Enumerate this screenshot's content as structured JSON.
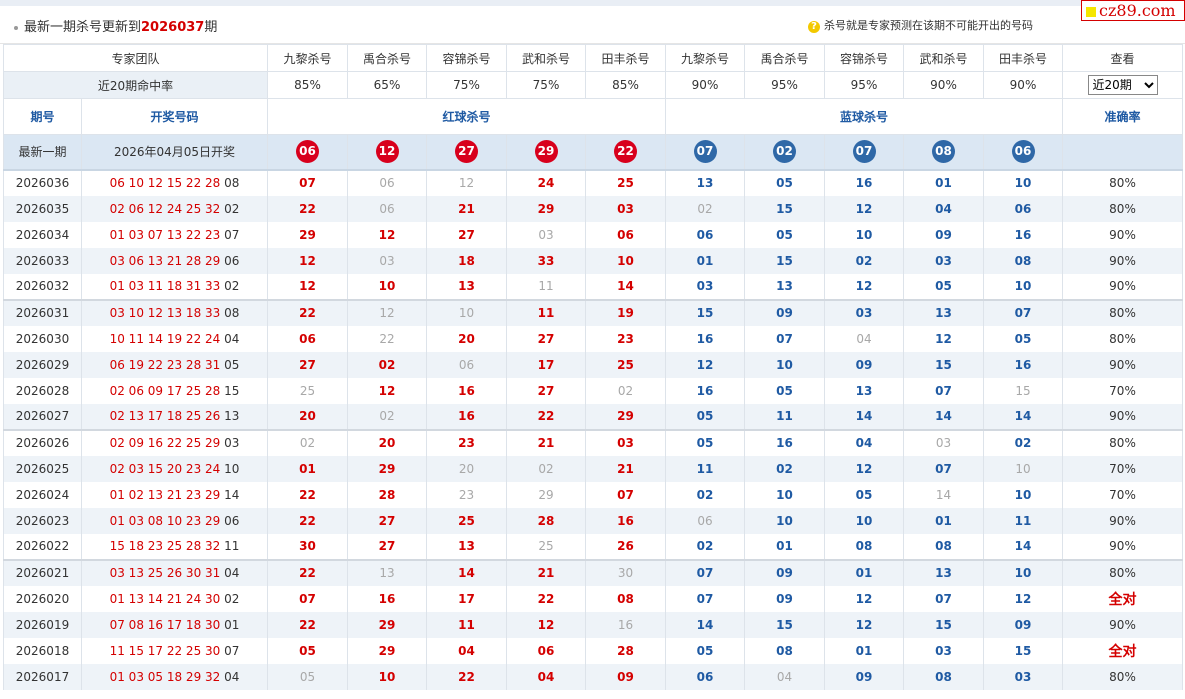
{
  "notice": {
    "prefix": "最新一期杀号更新到",
    "issue": "2026037",
    "suffix": "期"
  },
  "tip": {
    "icon": "question-icon",
    "text": "杀号就是专家预测在该期不可能开出的号码"
  },
  "logo": {
    "text": "cz89.com",
    "color": "#d40000"
  },
  "colors": {
    "red": "#d8001c",
    "blue": "#2f68a7",
    "header_bg": "#dbe7f3"
  },
  "experts": {
    "label": "专家团队",
    "names": [
      "九黎杀号",
      "禹合杀号",
      "容锦杀号",
      "武和杀号",
      "田丰杀号",
      "九黎杀号",
      "禹合杀号",
      "容锦杀号",
      "武和杀号",
      "田丰杀号"
    ],
    "view_label": "查看"
  },
  "hitrate": {
    "label": "近20期命中率",
    "values": [
      "85%",
      "65%",
      "75%",
      "75%",
      "85%",
      "90%",
      "95%",
      "95%",
      "90%",
      "90%"
    ],
    "select_value": "近20期"
  },
  "headers": {
    "issue": "期号",
    "draw": "开奖号码",
    "red": "红球杀号",
    "blue": "蓝球杀号",
    "accuracy": "准确率"
  },
  "latest": {
    "label": "最新一期",
    "date": "2026年04月05日开奖",
    "red": [
      "06",
      "12",
      "27",
      "29",
      "22"
    ],
    "blue": [
      "07",
      "02",
      "07",
      "08",
      "06"
    ]
  },
  "rows": [
    {
      "issue": "2026036",
      "draw": "06 10 12 15 22 28",
      "blue_ball": "08",
      "red": [
        "07",
        "06",
        "12",
        "24",
        "25"
      ],
      "blue": [
        "13",
        "05",
        "16",
        "01",
        "10"
      ],
      "acc": "80%"
    },
    {
      "issue": "2026035",
      "draw": "02 06 12 24 25 32",
      "blue_ball": "02",
      "red": [
        "22",
        "06",
        "21",
        "29",
        "03"
      ],
      "blue": [
        "02",
        "15",
        "12",
        "04",
        "06"
      ],
      "acc": "80%"
    },
    {
      "issue": "2026034",
      "draw": "01 03 07 13 22 23",
      "blue_ball": "07",
      "red": [
        "29",
        "12",
        "27",
        "03",
        "06"
      ],
      "blue": [
        "06",
        "05",
        "10",
        "09",
        "16"
      ],
      "acc": "90%"
    },
    {
      "issue": "2026033",
      "draw": "03 06 13 21 28 29",
      "blue_ball": "06",
      "red": [
        "12",
        "03",
        "18",
        "33",
        "10"
      ],
      "blue": [
        "01",
        "15",
        "02",
        "03",
        "08"
      ],
      "acc": "90%"
    },
    {
      "issue": "2026032",
      "draw": "01 03 11 18 31 33",
      "blue_ball": "02",
      "red": [
        "12",
        "10",
        "13",
        "11",
        "14"
      ],
      "blue": [
        "03",
        "13",
        "12",
        "05",
        "10"
      ],
      "acc": "90%"
    },
    {
      "issue": "2026031",
      "draw": "03 10 12 13 18 33",
      "blue_ball": "08",
      "red": [
        "22",
        "12",
        "10",
        "11",
        "19"
      ],
      "blue": [
        "15",
        "09",
        "03",
        "13",
        "07"
      ],
      "acc": "80%"
    },
    {
      "issue": "2026030",
      "draw": "10 11 14 19 22 24",
      "blue_ball": "04",
      "red": [
        "06",
        "22",
        "20",
        "27",
        "23"
      ],
      "blue": [
        "16",
        "07",
        "04",
        "12",
        "05"
      ],
      "acc": "80%"
    },
    {
      "issue": "2026029",
      "draw": "06 19 22 23 28 31",
      "blue_ball": "05",
      "red": [
        "27",
        "02",
        "06",
        "17",
        "25"
      ],
      "blue": [
        "12",
        "10",
        "09",
        "15",
        "16"
      ],
      "acc": "90%"
    },
    {
      "issue": "2026028",
      "draw": "02 06 09 17 25 28",
      "blue_ball": "15",
      "red": [
        "25",
        "12",
        "16",
        "27",
        "02"
      ],
      "blue": [
        "16",
        "05",
        "13",
        "07",
        "15"
      ],
      "acc": "70%"
    },
    {
      "issue": "2026027",
      "draw": "02 13 17 18 25 26",
      "blue_ball": "13",
      "red": [
        "20",
        "02",
        "16",
        "22",
        "29"
      ],
      "blue": [
        "05",
        "11",
        "14",
        "14",
        "14"
      ],
      "acc": "90%"
    },
    {
      "issue": "2026026",
      "draw": "02 09 16 22 25 29",
      "blue_ball": "03",
      "red": [
        "02",
        "20",
        "23",
        "21",
        "03"
      ],
      "blue": [
        "05",
        "16",
        "04",
        "03",
        "02"
      ],
      "acc": "80%"
    },
    {
      "issue": "2026025",
      "draw": "02 03 15 20 23 24",
      "blue_ball": "10",
      "red": [
        "01",
        "29",
        "20",
        "02",
        "21"
      ],
      "blue": [
        "11",
        "02",
        "12",
        "07",
        "10"
      ],
      "acc": "70%"
    },
    {
      "issue": "2026024",
      "draw": "01 02 13 21 23 29",
      "blue_ball": "14",
      "red": [
        "22",
        "28",
        "23",
        "29",
        "07"
      ],
      "blue": [
        "02",
        "10",
        "05",
        "14",
        "10"
      ],
      "acc": "70%"
    },
    {
      "issue": "2026023",
      "draw": "01 03 08 10 23 29",
      "blue_ball": "06",
      "red": [
        "22",
        "27",
        "25",
        "28",
        "16"
      ],
      "blue": [
        "06",
        "10",
        "10",
        "01",
        "11"
      ],
      "acc": "90%"
    },
    {
      "issue": "2026022",
      "draw": "15 18 23 25 28 32",
      "blue_ball": "11",
      "red": [
        "30",
        "27",
        "13",
        "25",
        "26"
      ],
      "blue": [
        "02",
        "01",
        "08",
        "08",
        "14"
      ],
      "acc": "90%"
    },
    {
      "issue": "2026021",
      "draw": "03 13 25 26 30 31",
      "blue_ball": "04",
      "red": [
        "22",
        "13",
        "14",
        "21",
        "30"
      ],
      "blue": [
        "07",
        "09",
        "01",
        "13",
        "10"
      ],
      "acc": "80%"
    },
    {
      "issue": "2026020",
      "draw": "01 13 14 21 24 30",
      "blue_ball": "02",
      "red": [
        "07",
        "16",
        "17",
        "22",
        "08"
      ],
      "blue": [
        "07",
        "09",
        "12",
        "07",
        "12"
      ],
      "acc": "全对"
    },
    {
      "issue": "2026019",
      "draw": "07 08 16 17 18 30",
      "blue_ball": "01",
      "red": [
        "22",
        "29",
        "11",
        "12",
        "16"
      ],
      "blue": [
        "14",
        "15",
        "12",
        "15",
        "09"
      ],
      "acc": "90%"
    },
    {
      "issue": "2026018",
      "draw": "11 15 17 22 25 30",
      "blue_ball": "07",
      "red": [
        "05",
        "29",
        "04",
        "06",
        "28"
      ],
      "blue": [
        "05",
        "08",
        "01",
        "03",
        "15"
      ],
      "acc": "全对"
    },
    {
      "issue": "2026017",
      "draw": "01 03 05 18 29 32",
      "blue_ball": "04",
      "red": [
        "05",
        "10",
        "22",
        "04",
        "09"
      ],
      "blue": [
        "06",
        "04",
        "09",
        "08",
        "03"
      ],
      "acc": "80%"
    }
  ]
}
